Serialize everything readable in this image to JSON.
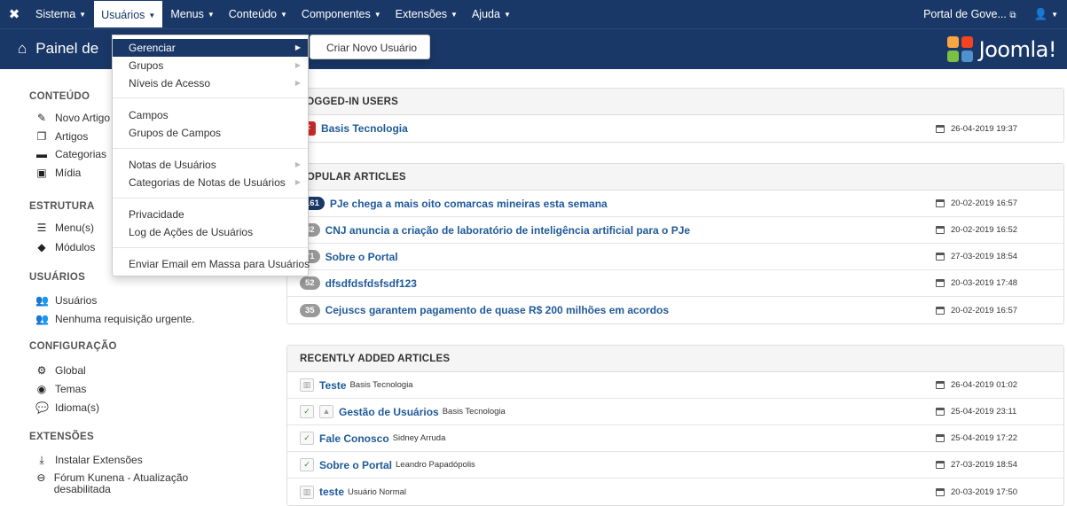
{
  "navbar": {
    "logo_icon": "joomla-logo-icon",
    "menus": [
      {
        "label": "Sistema"
      },
      {
        "label": "Usuários"
      },
      {
        "label": "Menus"
      },
      {
        "label": "Conteúdo"
      },
      {
        "label": "Componentes"
      },
      {
        "label": "Extensões"
      },
      {
        "label": "Ajuda"
      }
    ],
    "site_link": "Portal de Gove...",
    "user_icon": "user-icon"
  },
  "subhead": {
    "title": "Painel de",
    "brand": "Joomla!"
  },
  "dropdown": {
    "items": [
      {
        "label": "Gerenciar"
      },
      {
        "label": "Grupos"
      },
      {
        "label": "Níveis de Acesso"
      },
      {
        "label": "Campos"
      },
      {
        "label": "Grupos de Campos"
      },
      {
        "label": "Notas de Usuários"
      },
      {
        "label": "Categorias de Notas de Usuários"
      },
      {
        "label": "Privacidade"
      },
      {
        "label": "Log de Ações de Usuários"
      },
      {
        "label": "Enviar Email em Massa para Usuários"
      }
    ],
    "submenu": {
      "label": "Criar Novo Usuário"
    }
  },
  "sidebar": {
    "sections": [
      {
        "heading": "CONTEÚDO",
        "items": [
          {
            "label": "Novo Artigo",
            "icon": "pencil-icon"
          },
          {
            "label": "Artigos",
            "icon": "stack-icon"
          },
          {
            "label": "Categorias",
            "icon": "folder-icon"
          },
          {
            "label": "Mídia",
            "icon": "image-icon"
          }
        ]
      },
      {
        "heading": "ESTRUTURA",
        "items": [
          {
            "label": "Menu(s)",
            "icon": "list-icon"
          },
          {
            "label": "Módulos",
            "icon": "cube-icon"
          }
        ]
      },
      {
        "heading": "USUÁRIOS",
        "items": [
          {
            "label": "Usuários",
            "icon": "users-icon"
          },
          {
            "label": "Nenhuma requisição urgente.",
            "icon": "users-icon"
          }
        ]
      },
      {
        "heading": "CONFIGURAÇÃO",
        "items": [
          {
            "label": "Global",
            "icon": "cog-icon"
          },
          {
            "label": "Temas",
            "icon": "eye-icon"
          },
          {
            "label": "Idioma(s)",
            "icon": "comments-icon"
          }
        ]
      },
      {
        "heading": "EXTENSÕES",
        "items": [
          {
            "label": "Instalar Extensões",
            "icon": "upload-icon"
          },
          {
            "label": "Fórum Kunena - Atualização desabilitada",
            "icon": "minus-circle-icon"
          }
        ]
      }
    ]
  },
  "panels": {
    "logged_in": {
      "heading": "LOGGED-IN USERS",
      "rows": [
        {
          "title": "Basis Tecnologia",
          "date": "26-04-2019 19:37"
        }
      ]
    },
    "popular": {
      "heading": "POPULAR ARTICLES",
      "rows": [
        {
          "hits": "161",
          "title": "PJe chega a mais oito comarcas mineiras esta semana",
          "date": "20-02-2019 16:57"
        },
        {
          "hits": "82",
          "title": "CNJ anuncia a criação de laboratório de inteligência artificial para o PJe",
          "date": "20-02-2019 16:52"
        },
        {
          "hits": "71",
          "title": "Sobre o Portal",
          "date": "27-03-2019 18:54"
        },
        {
          "hits": "52",
          "title": "dfsdfdsfdsfsdf123",
          "date": "20-03-2019 17:48"
        },
        {
          "hits": "35",
          "title": "Cejuscs garantem pagamento de quase R$ 200 milhões em acordos",
          "date": "20-02-2019 16:57"
        }
      ]
    },
    "recent": {
      "heading": "RECENTLY ADDED ARTICLES",
      "rows": [
        {
          "title": "Teste",
          "author": "Basis Tecnologia",
          "date": "26-04-2019 01:02"
        },
        {
          "title": "Gestão de Usuários",
          "author": "Basis Tecnologia",
          "date": "25-04-2019 23:11"
        },
        {
          "title": "Fale Conosco",
          "author": "Sidney Arruda",
          "date": "25-04-2019 17:22"
        },
        {
          "title": "Sobre o Portal",
          "author": "Leandro Papadópolis",
          "date": "27-03-2019 18:54"
        },
        {
          "title": "teste",
          "author": "Usuário Normal",
          "date": "20-03-2019 17:50"
        }
      ]
    }
  },
  "colors": {
    "header_bg": "#1a3867",
    "link": "#1f5a99"
  }
}
